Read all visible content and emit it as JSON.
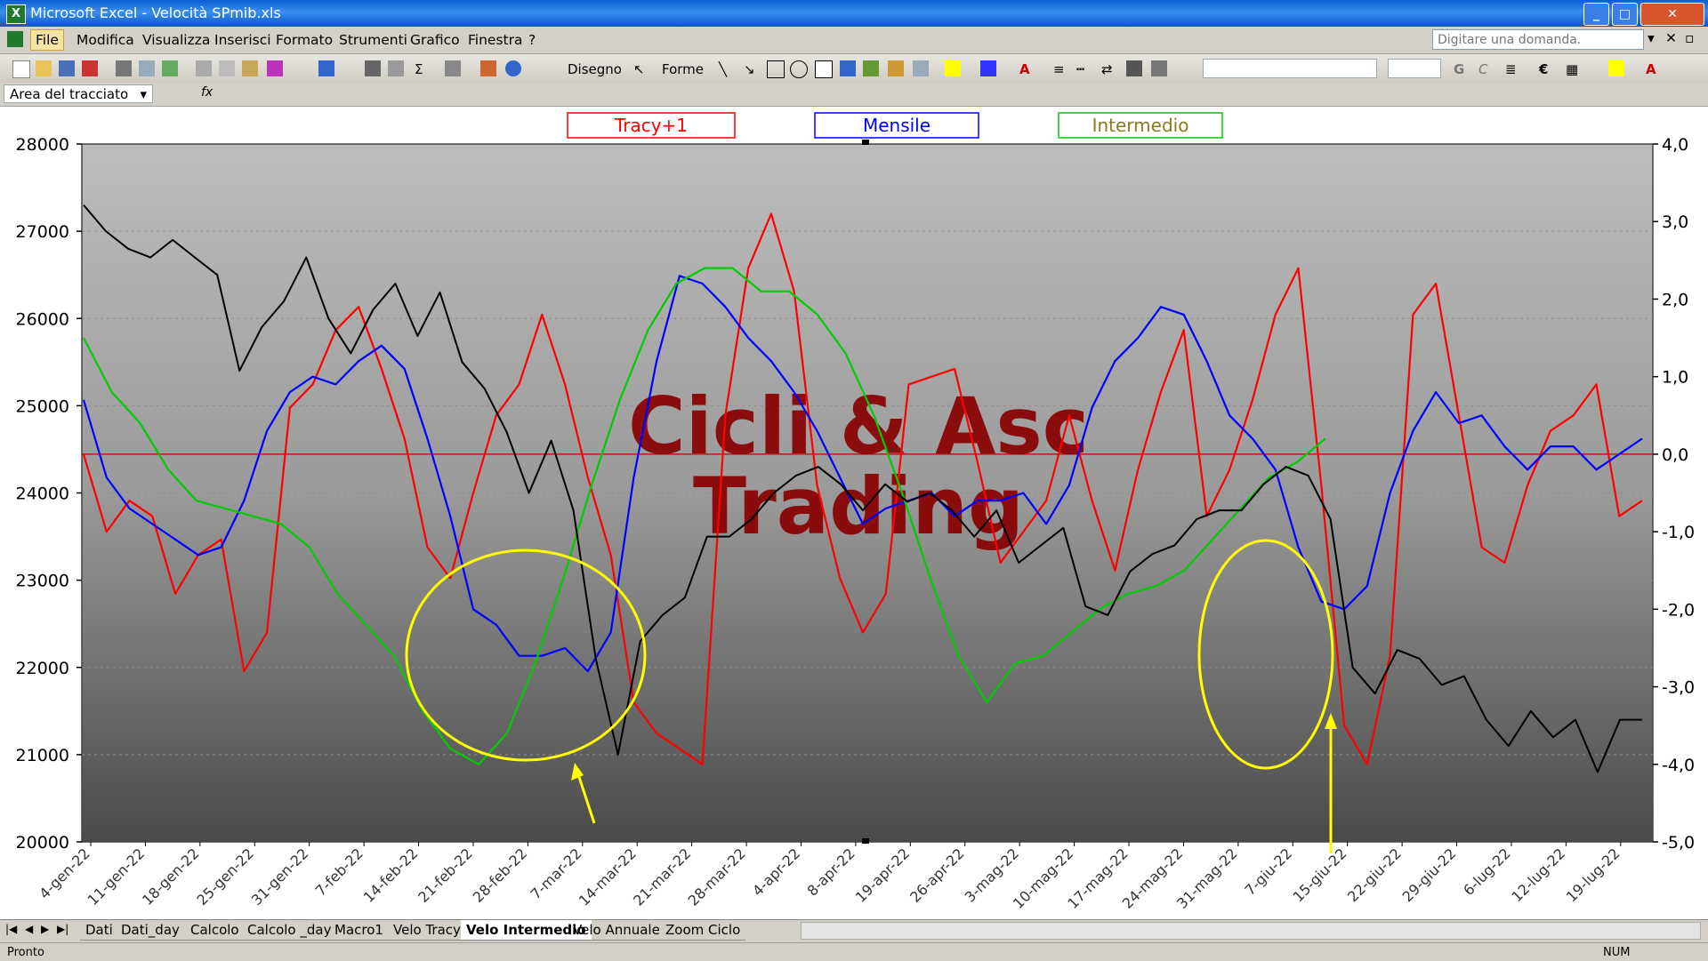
{
  "window": {
    "title": "Microsoft Excel - Velocità SPmib.xls",
    "app_icon": "excel-icon"
  },
  "menu": {
    "items": [
      "File",
      "Modifica",
      "Visualizza",
      "Inserisci",
      "Formato",
      "Strumenti",
      "Grafico",
      "Finestra",
      "?"
    ],
    "ask_placeholder": "Digitare una domanda."
  },
  "toolbar": {
    "draw_label": "Disegno",
    "shapes_label": "Forme"
  },
  "namebox": {
    "value": "Area del tracciato",
    "fx": "fx"
  },
  "chart_data": {
    "type": "line",
    "legend": [
      "Tracy+1",
      "Mensile",
      "Intermedio"
    ],
    "watermark": [
      "Cicli & Asc",
      "Trading"
    ],
    "y_left": {
      "ticks": [
        "28000",
        "27000",
        "26000",
        "25000",
        "24000",
        "23000",
        "22000",
        "21000",
        "20000"
      ],
      "range": [
        20000,
        28000
      ]
    },
    "y_right": {
      "ticks": [
        "4,0",
        "3,0",
        "2,0",
        "1,0",
        "0,0",
        "-1,0",
        "-2,0",
        "-3,0",
        "-4,0",
        "-5,0"
      ],
      "range": [
        -5,
        4
      ]
    },
    "x_ticks": [
      "4-gen-22",
      "11-gen-22",
      "18-gen-22",
      "25-gen-22",
      "31-gen-22",
      "7-feb-22",
      "14-feb-22",
      "21-feb-22",
      "28-feb-22",
      "7-mar-22",
      "14-mar-22",
      "21-mar-22",
      "28-mar-22",
      "4-apr-22",
      "8-apr-22",
      "19-apr-22",
      "26-apr-22",
      "3-mag-22",
      "10-mag-22",
      "17-mag-22",
      "24-mag-22",
      "31-mag-22",
      "7-giu-22",
      "15-giu-22",
      "22-giu-22",
      "29-giu-22",
      "6-lug-22",
      "12-lug-22",
      "19-lug-22"
    ],
    "series": [
      {
        "name": "Tracy+1",
        "color": "#ff0000",
        "axis": "right",
        "values": [
          0,
          -1,
          -0.6,
          -0.8,
          -1.8,
          -1.3,
          -1.1,
          -2.8,
          -2.3,
          0.6,
          0.9,
          1.6,
          1.9,
          1.1,
          0.2,
          -1.2,
          -1.6,
          -0.5,
          0.5,
          0.9,
          1.8,
          0.9,
          -0.3,
          -1.3,
          -3.2,
          -3.6,
          -3.8,
          -4.0,
          0.5,
          2.4,
          3.1,
          2.1,
          -0.4,
          -1.6,
          -2.3,
          -1.8,
          0.9,
          1.0,
          1.1,
          -0.1,
          -1.4,
          -1.0,
          -0.6,
          0.5,
          -0.6,
          -1.5,
          -0.2,
          0.8,
          1.6,
          -0.8,
          -0.2,
          0.7,
          1.8,
          2.4,
          -0.4,
          -3.5,
          -4.0,
          -2.6,
          1.8,
          2.2,
          0.5,
          -1.2,
          -1.4,
          -0.4,
          0.3,
          0.5,
          0.9,
          -0.8,
          -0.6
        ]
      },
      {
        "name": "Mensile",
        "color": "#0000ff",
        "axis": "right",
        "values": [
          0.7,
          -0.3,
          -0.7,
          -0.9,
          -1.1,
          -1.3,
          -1.2,
          -0.6,
          0.3,
          0.8,
          1.0,
          0.9,
          1.2,
          1.4,
          1.1,
          0.2,
          -0.8,
          -2.0,
          -2.2,
          -2.6,
          -2.6,
          -2.5,
          -2.8,
          -2.3,
          -0.3,
          1.2,
          2.3,
          2.2,
          1.9,
          1.5,
          1.2,
          0.8,
          0.3,
          -0.3,
          -0.9,
          -0.7,
          -0.6,
          -0.5,
          -0.8,
          -0.6,
          -0.6,
          -0.5,
          -0.9,
          -0.4,
          0.6,
          1.2,
          1.5,
          1.9,
          1.8,
          1.2,
          0.5,
          0.2,
          -0.2,
          -1.2,
          -1.9,
          -2.0,
          -1.7,
          -0.5,
          0.3,
          0.8,
          0.4,
          0.5,
          0.1,
          -0.2,
          0.1,
          0.1,
          -0.2,
          0.0,
          0.2
        ]
      },
      {
        "name": "Intermedio",
        "color": "#00cc00",
        "axis": "right",
        "values": [
          1.5,
          0.8,
          0.4,
          -0.2,
          -0.6,
          -0.7,
          -0.8,
          -0.9,
          -1.2,
          -1.8,
          -2.2,
          -2.6,
          -3.3,
          -3.8,
          -4.0,
          -3.6,
          -2.7,
          -1.6,
          -0.4,
          0.7,
          1.6,
          2.2,
          2.4,
          2.4,
          2.1,
          2.1,
          1.8,
          1.3,
          0.5,
          -0.5,
          -1.6,
          -2.6,
          -3.2,
          -2.7,
          -2.6,
          -2.3,
          -2.0,
          -1.8,
          -1.7,
          -1.5,
          -1.1,
          -0.7,
          -0.3,
          -0.1,
          0.2
        ]
      },
      {
        "name": "SPmib",
        "color": "#000000",
        "axis": "left",
        "values": [
          27300,
          27000,
          26800,
          26700,
          26900,
          26700,
          26500,
          25400,
          25900,
          26200,
          26700,
          26000,
          25600,
          26100,
          26400,
          25800,
          26300,
          25500,
          25200,
          24700,
          24000,
          24600,
          23800,
          22100,
          21000,
          22300,
          22600,
          22800,
          23500,
          23500,
          23700,
          24000,
          24200,
          24300,
          24100,
          23800,
          24100,
          23900,
          24000,
          23800,
          23500,
          23800,
          23200,
          23400,
          23600,
          22700,
          22600,
          23100,
          23300,
          23400,
          23700,
          23800,
          23800,
          24100,
          24300,
          24200,
          23700,
          22000,
          21700,
          22200,
          22100,
          21800,
          21900,
          21400,
          21100,
          21500,
          21200,
          21400,
          20800,
          21400,
          21400
        ]
      }
    ]
  },
  "sheet_tabs": [
    "Dati",
    "Dati_day",
    "Calcolo",
    "Calcolo _day",
    "Macro1",
    "Velo Tracy",
    "Velo Intermedio",
    "Velo Annuale",
    "Zoom Ciclo"
  ],
  "active_tab": "Velo Intermedio",
  "status": {
    "left": "Pronto",
    "num": "NUM"
  }
}
